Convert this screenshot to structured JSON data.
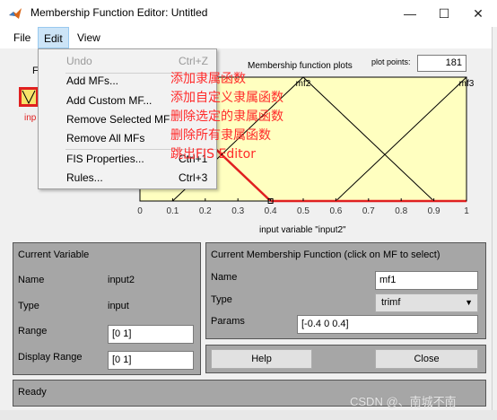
{
  "window": {
    "title": "Membership Function Editor: Untitled",
    "minimize": "—",
    "maximize": "☐",
    "close": "✕"
  },
  "menubar": [
    "File",
    "Edit",
    "View"
  ],
  "edit_menu": {
    "items": [
      {
        "label": "Undo",
        "accel": "Ctrl+Z",
        "disabled": true
      },
      {
        "label": "Add MFs...",
        "accel": ""
      },
      {
        "label": "Add Custom MF...",
        "accel": ""
      },
      {
        "label": "Remove Selected MF",
        "accel": ""
      },
      {
        "label": "Remove All MFs",
        "accel": ""
      },
      {
        "label": "FIS Properties...",
        "accel": "Ctrl+1"
      },
      {
        "label": "Rules...",
        "accel": "Ctrl+3"
      }
    ]
  },
  "annotations": [
    "添加隶属函数",
    "添加自定义隶属函数",
    "删除选定的隶属函数",
    "删除所有隶属函数",
    "跳出FIS Editor"
  ],
  "plot": {
    "title": "Membership function plots",
    "plot_points_label": "plot points:",
    "plot_points": "181",
    "xlabel": "input variable \"input2\"",
    "xticks": [
      "0",
      "0.1",
      "0.2",
      "0.3",
      "0.4",
      "0.5",
      "0.6",
      "0.7",
      "0.8",
      "0.9",
      "1"
    ],
    "mf_labels": [
      "mf2",
      "mf3"
    ],
    "highlight_color": "#e02020",
    "curve_color": "#000000",
    "bg_color": "#ffffc0"
  },
  "chart_data": {
    "type": "line",
    "xlabel": "input variable \"input2\"",
    "xlim": [
      0,
      1
    ],
    "ylim": [
      0,
      1
    ],
    "series": [
      {
        "name": "mf1",
        "x": [
          -0.4,
          0,
          0.4
        ],
        "y": [
          0,
          1,
          0
        ],
        "selected": true
      },
      {
        "name": "mf2",
        "x": [
          0.1,
          0.5,
          0.9
        ],
        "y": [
          0,
          1,
          0
        ]
      },
      {
        "name": "mf3",
        "x": [
          0.6,
          1,
          1.4
        ],
        "y": [
          0,
          1,
          0
        ]
      }
    ]
  },
  "left_fragments": {
    "letter": "F",
    "input_label": "inp"
  },
  "current_variable": {
    "title": "Current Variable",
    "name_label": "Name",
    "name_value": "input2",
    "type_label": "Type",
    "type_value": "input",
    "range_label": "Range",
    "range_value": "[0 1]",
    "display_range_label": "Display Range",
    "display_range_value": "[0 1]"
  },
  "current_mf": {
    "title": "Current Membership Function (click on MF to select)",
    "name_label": "Name",
    "name_value": "mf1",
    "type_label": "Type",
    "type_value": "trimf",
    "params_label": "Params",
    "params_value": "[-0.4 0 0.4]"
  },
  "buttons": {
    "help": "Help",
    "close": "Close"
  },
  "status": "Ready",
  "watermark": "CSDN @、南城不南"
}
